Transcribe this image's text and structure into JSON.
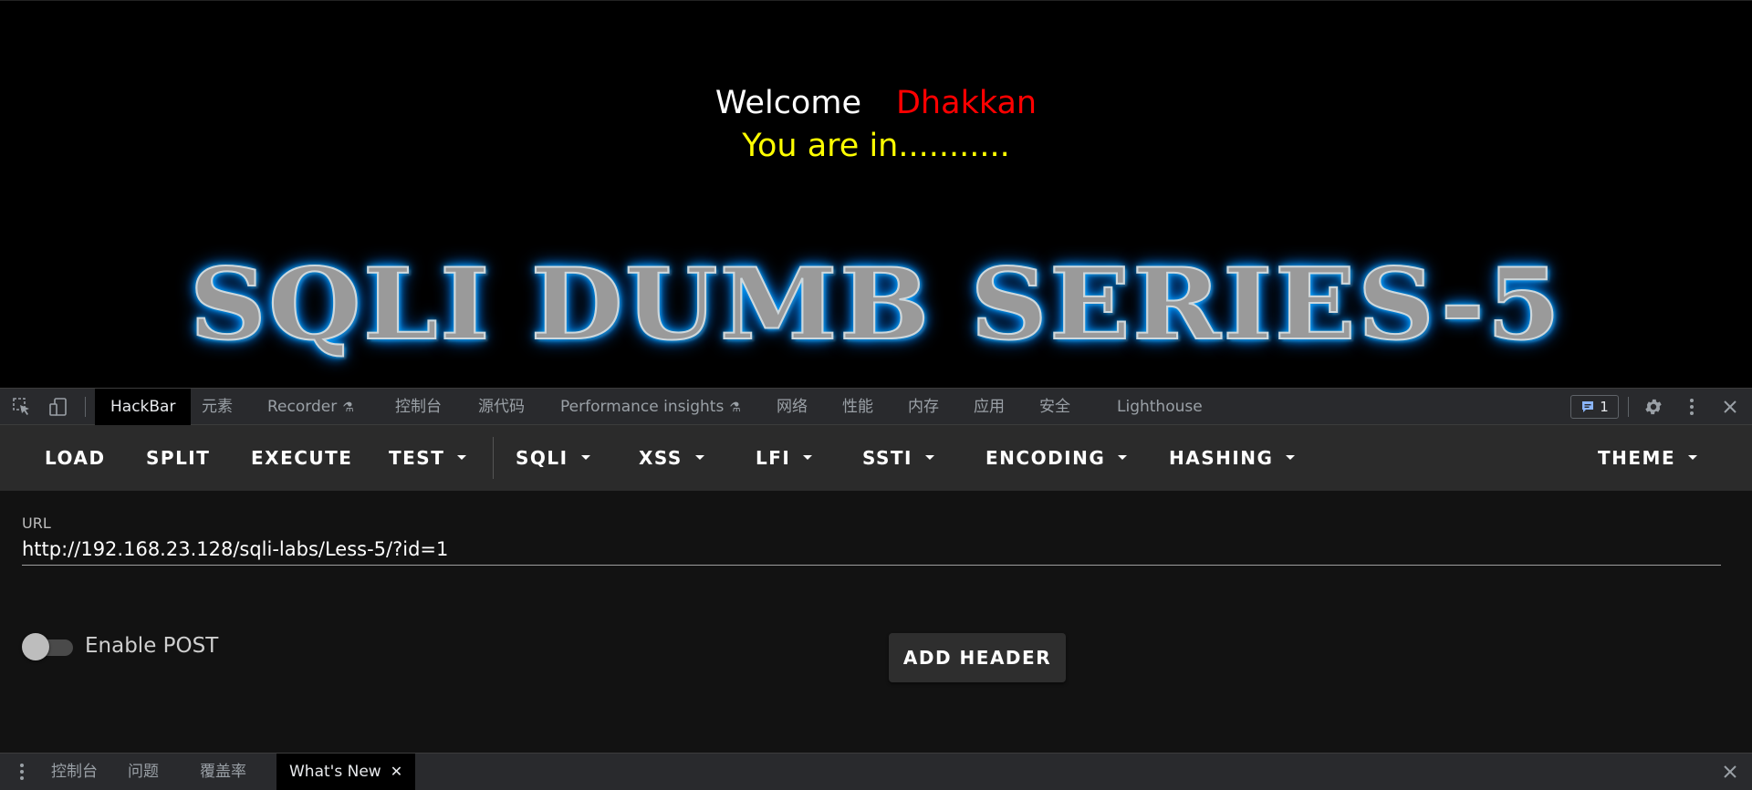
{
  "page": {
    "welcome_text": "Welcome",
    "user_name": "Dhakkan",
    "status_text": "You are in...........",
    "title": "SQLI DUMB SERIES-5"
  },
  "devtools": {
    "tabs": [
      {
        "label": "HackBar",
        "active": true
      },
      {
        "label": "元素"
      },
      {
        "label": "Recorder",
        "experimental": true
      },
      {
        "label": "控制台"
      },
      {
        "label": "源代码"
      },
      {
        "label": "Performance insights",
        "experimental": true
      },
      {
        "label": "网络"
      },
      {
        "label": "性能"
      },
      {
        "label": "内存"
      },
      {
        "label": "应用"
      },
      {
        "label": "安全"
      },
      {
        "label": "Lighthouse"
      }
    ],
    "issues_count": "1",
    "icons": [
      "inspect-element-icon",
      "device-toolbar-icon",
      "issues-icon",
      "settings-gear-icon",
      "more-options-icon",
      "close-icon"
    ]
  },
  "hackbar": {
    "toolbar": {
      "load": "LOAD",
      "split": "SPLIT",
      "execute": "EXECUTE",
      "test": "TEST",
      "sqli": "SQLI",
      "xss": "XSS",
      "lfi": "LFI",
      "ssti": "SSTI",
      "encoding": "ENCODING",
      "hashing": "HASHING",
      "theme": "THEME"
    },
    "url_label": "URL",
    "url_value": "http://192.168.23.128/sqli-labs/Less-5/?id=1",
    "enable_post_label": "Enable POST",
    "enable_post_on": false,
    "add_header_label": "ADD HEADER"
  },
  "drawer": {
    "tabs": [
      {
        "label": "控制台"
      },
      {
        "label": "问题"
      },
      {
        "label": "覆盖率"
      },
      {
        "label": "What's New",
        "active": true
      }
    ]
  },
  "colors": {
    "welcome": "#ffffff",
    "user_name": "#ff0000",
    "status": "#ffff00",
    "title_glow": "#00aaff",
    "devtools_bg": "#292a2d",
    "hackbar_toolbar_bg": "#2b2b2b",
    "hackbar_body_bg": "#121212"
  }
}
